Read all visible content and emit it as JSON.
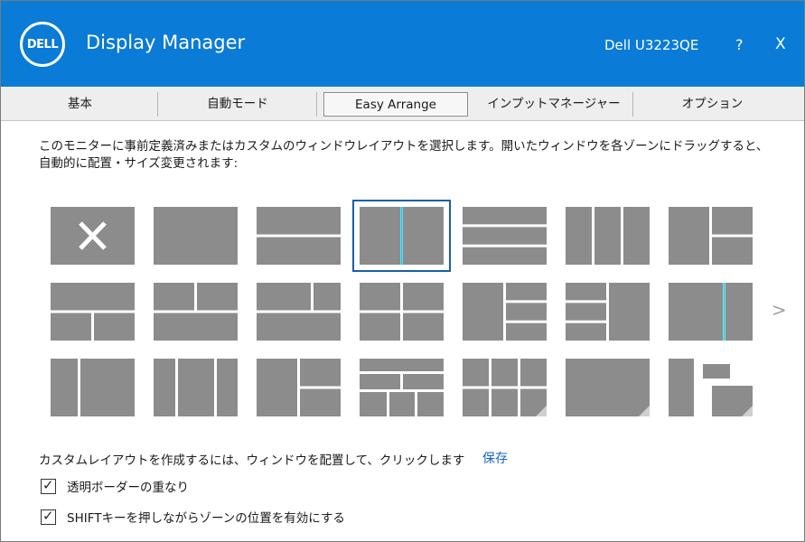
{
  "app": {
    "brand_text": "DELL",
    "title": "Display Manager",
    "monitor_name": "Dell U3223QE",
    "help_label": "?",
    "close_label": "X"
  },
  "colors": {
    "titlebar": "#0a7bd6",
    "tile": "#8c8c8c",
    "divider": "#ffffff",
    "selected_outline": "#1b5fa8",
    "accent_line": "#16c7e0",
    "link": "#1464c3"
  },
  "tabs": [
    {
      "label": "基本",
      "active": false
    },
    {
      "label": "自動モード",
      "active": false
    },
    {
      "label": "Easy Arrange",
      "active": true
    },
    {
      "label": "インプットマネージャー",
      "active": false
    },
    {
      "label": "オプション",
      "active": false
    }
  ],
  "description": "このモニターに事前定義済みまたはカスタムのウィンドウレイアウトを選択します。開いたウィンドウを各ゾーンにドラッグすると、自動的に配置・サイズ変更されます:",
  "layouts": [
    {
      "id": "none",
      "icon": "x-icon"
    },
    {
      "id": "single"
    },
    {
      "id": "two-rows"
    },
    {
      "id": "two-columns",
      "selected": true
    },
    {
      "id": "three-rows"
    },
    {
      "id": "three-columns"
    },
    {
      "id": "left-plus-right-two"
    },
    {
      "id": "top-plus-bottom-two"
    },
    {
      "id": "top-two-plus-bottom"
    },
    {
      "id": "two-by-two-offset"
    },
    {
      "id": "grid-2x2"
    },
    {
      "id": "left-plus-right-three"
    },
    {
      "id": "left-three-plus-right"
    },
    {
      "id": "wide-plus-narrow"
    },
    {
      "id": "narrow-plus-wide"
    },
    {
      "id": "three-cols-offset"
    },
    {
      "id": "three-cols-equal"
    },
    {
      "id": "mixed-grid"
    },
    {
      "id": "three-plus-three"
    },
    {
      "id": "custom-corner"
    },
    {
      "id": "custom-floating"
    }
  ],
  "next_label": ">",
  "custom_text": "カスタムレイアウトを作成するには、ウィンドウを配置して、クリックします",
  "save_label": "保存",
  "options": [
    {
      "label": "透明ボーダーの重なり",
      "checked": true
    },
    {
      "label": "SHIFTキーを押しながらゾーンの位置を有効にする",
      "checked": true
    }
  ],
  "check_mark": "✓"
}
